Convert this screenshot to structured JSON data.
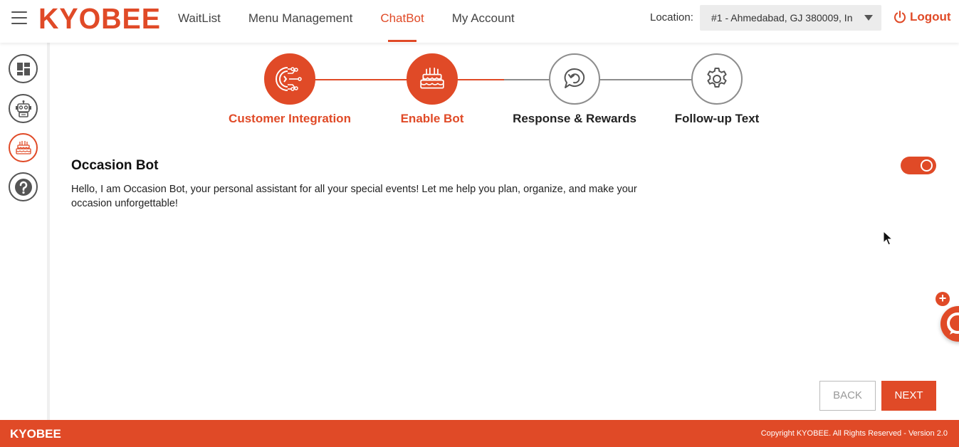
{
  "header": {
    "logo": "KYOBEE",
    "nav": [
      {
        "label": "WaitList",
        "active": false
      },
      {
        "label": "Menu Management",
        "active": false
      },
      {
        "label": "ChatBot",
        "active": true
      },
      {
        "label": "My Account",
        "active": false
      }
    ],
    "location_label": "Location:",
    "location_value": "#1 - Ahmedabad, GJ 380009, In",
    "logout_label": "Logout"
  },
  "sidebar": {
    "items": [
      {
        "icon": "dashboard-icon",
        "active": false
      },
      {
        "icon": "robot-icon",
        "active": false
      },
      {
        "icon": "cake-icon",
        "active": true
      },
      {
        "icon": "help-icon",
        "active": false
      }
    ]
  },
  "stepper": {
    "steps": [
      {
        "label": "Customer Integration",
        "icon": "integration-icon",
        "done": true
      },
      {
        "label": "Enable Bot",
        "icon": "cake-icon",
        "done": true
      },
      {
        "label": "Response & Rewards",
        "icon": "reply-chat-icon",
        "done": false
      },
      {
        "label": "Follow-up Text",
        "icon": "gear-icon",
        "done": false
      }
    ]
  },
  "bot": {
    "title": "Occasion Bot",
    "description": "Hello, I am Occasion Bot, your personal assistant for all your special events! Let me help you plan, organize, and make your occasion unforgettable!",
    "enabled": true
  },
  "actions": {
    "back_label": "BACK",
    "next_label": "NEXT"
  },
  "footer": {
    "brand": "KYOBEE",
    "copyright": "Copyright KYOBEE. All Rights Reserved - Version 2.0"
  },
  "colors": {
    "brand": "#e04a27",
    "inactive_step": "#8d8d8d"
  }
}
